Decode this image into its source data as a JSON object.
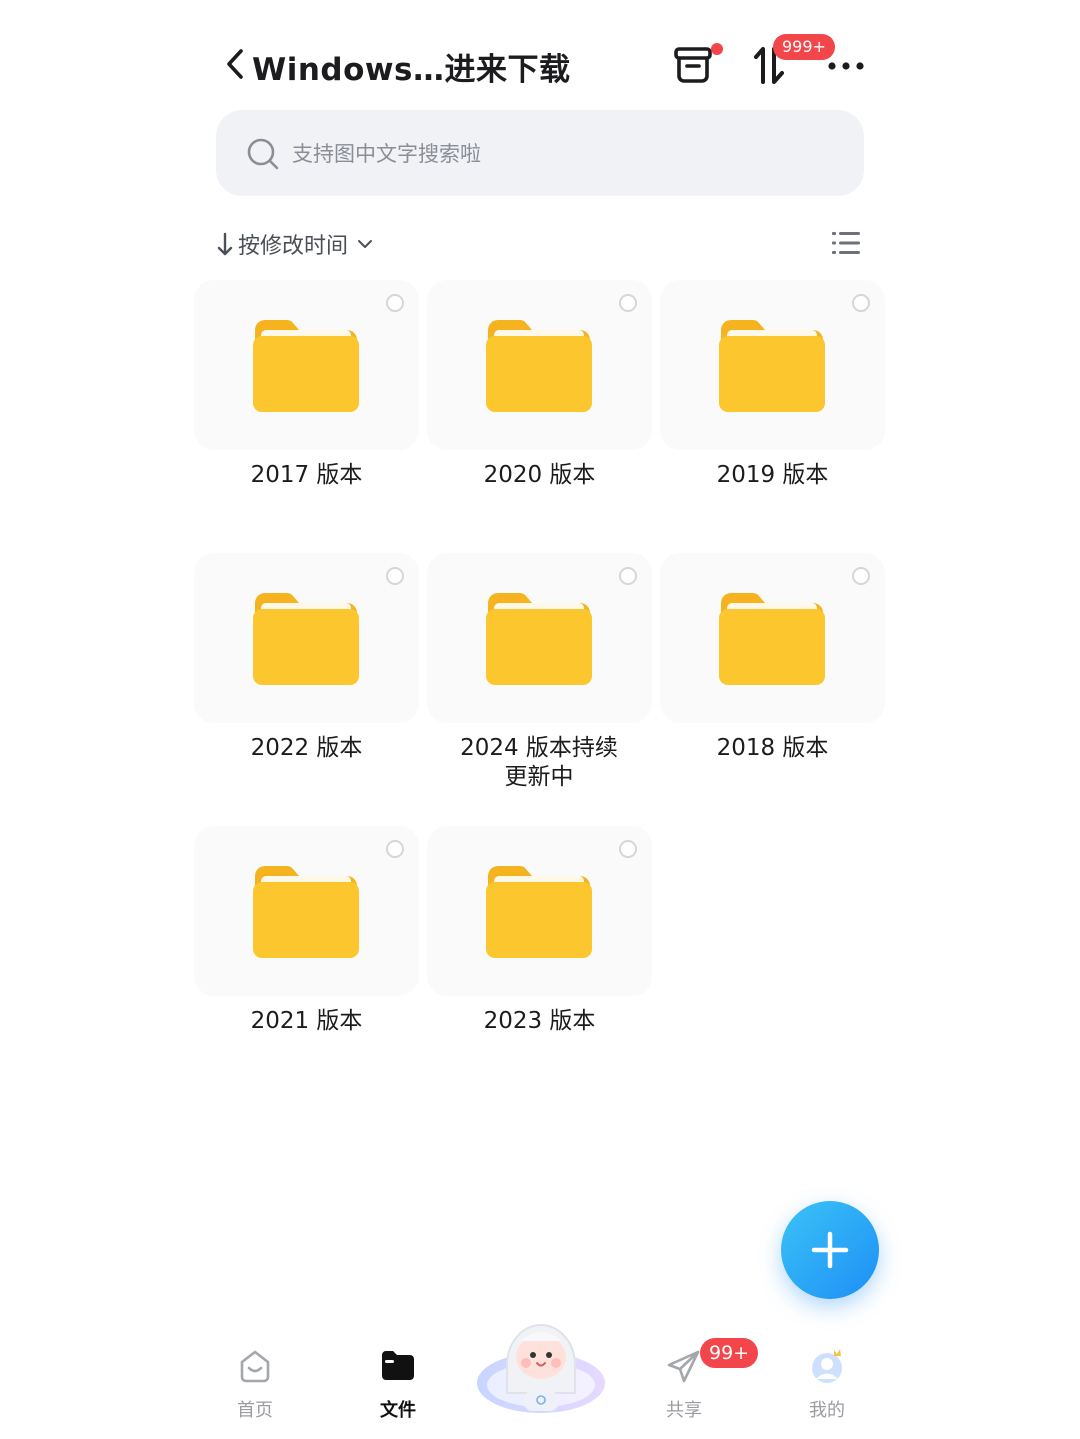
{
  "header": {
    "title": "Windows…进来下载",
    "transfer_badge": "999+",
    "icons": {
      "back": "chevron-left-icon",
      "trash": "recycle-bin-icon",
      "transfer": "transfer-arrows-icon",
      "more": "more-dots-icon"
    },
    "colors": {
      "badge": "#f2464b"
    }
  },
  "search": {
    "placeholder": "支持图中文字搜索啦"
  },
  "sort": {
    "arrow": "↓",
    "label": "按修改时间"
  },
  "folders": [
    {
      "name": "2017 版本"
    },
    {
      "name": "2020 版本"
    },
    {
      "name": "2019 版本"
    },
    {
      "name": "2022 版本"
    },
    {
      "name": "2024 版本持续更新中"
    },
    {
      "name": "2018 版本"
    },
    {
      "name": "2021 版本"
    },
    {
      "name": "2023 版本"
    }
  ],
  "folder_color": "#fcc62f",
  "fab": {
    "icon": "plus-icon",
    "color": "#1d8ff5"
  },
  "bottom_nav": {
    "items": [
      {
        "label": "首页",
        "icon": "home-icon"
      },
      {
        "label": "文件",
        "icon": "folder-icon",
        "active": true
      },
      {
        "label": "共享",
        "icon": "paper-plane-icon"
      },
      {
        "label": "我的",
        "icon": "profile-icon"
      }
    ],
    "share_badge": "99+"
  }
}
